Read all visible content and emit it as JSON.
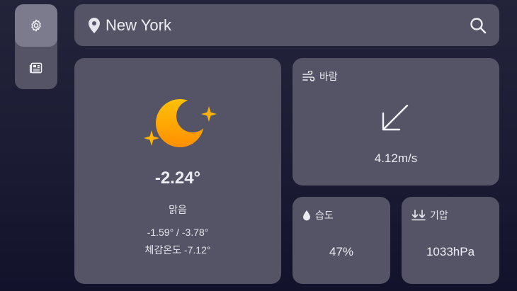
{
  "search": {
    "value": "New York",
    "placeholder": ""
  },
  "current": {
    "icon": "crescent-moon-icon",
    "temperature": "-2.24°",
    "condition": "맑음",
    "range": "-1.59° / -3.78°",
    "feels_like": "체감온도 -7.12°"
  },
  "wind": {
    "title": "바람",
    "value": "4.12m/s",
    "direction_icon": "arrow-down-left-icon"
  },
  "humidity": {
    "title": "습도",
    "value": "47%"
  },
  "pressure": {
    "title": "기압",
    "value": "1033hPa"
  },
  "nav": {
    "items": [
      {
        "icon": "gear-icon",
        "active": true
      },
      {
        "icon": "newspaper-icon",
        "active": false
      }
    ]
  },
  "colors": {
    "moon_top": "#ffc107",
    "moon_bottom": "#ff8f00",
    "card": "#545466",
    "active_nav": "#7b7b8d"
  }
}
